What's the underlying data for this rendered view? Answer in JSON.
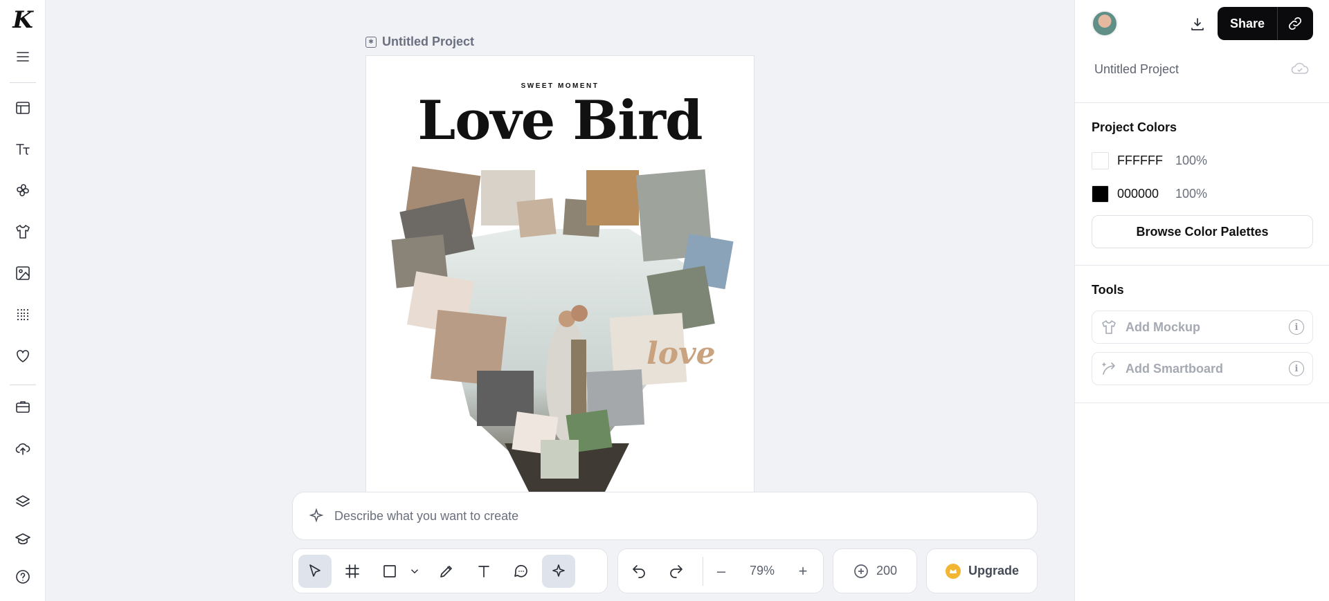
{
  "app": {
    "logo_letter": "K"
  },
  "canvas": {
    "project_name": "Untitled Project",
    "artboard": {
      "kicker": "SWEET MOMENT",
      "title": "Love Bird",
      "balloon_text": "love"
    }
  },
  "prompt": {
    "placeholder": "Describe what you want to create"
  },
  "toolbar": {
    "zoom": "79%",
    "zoom_minus": "–",
    "zoom_plus": "+",
    "credits": "200",
    "upgrade_label": "Upgrade"
  },
  "right_panel": {
    "share_label": "Share",
    "project_title": "Untitled Project",
    "colors_title": "Project Colors",
    "colors": [
      {
        "hex": "FFFFFF",
        "opacity": "100%",
        "swatch": "#ffffff"
      },
      {
        "hex": "000000",
        "opacity": "100%",
        "swatch": "#000000"
      }
    ],
    "palette_button": "Browse Color Palettes",
    "tools_title": "Tools",
    "tools": [
      {
        "label": "Add Mockup"
      },
      {
        "label": "Add Smartboard"
      }
    ]
  },
  "colors": {
    "accent_dark": "#0b0b0d",
    "active_tool_bg": "#dfe3eb",
    "upgrade_crown": "#f2b632"
  }
}
